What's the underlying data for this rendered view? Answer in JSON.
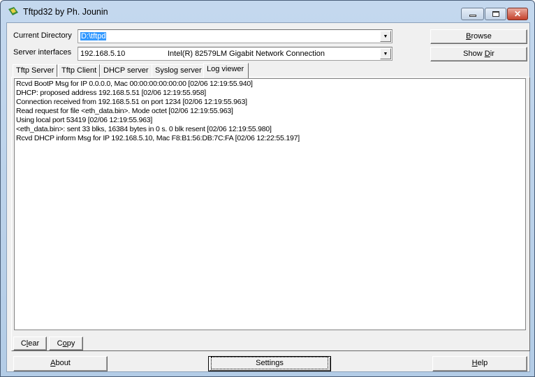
{
  "window": {
    "title": "Tftpd32 by Ph. Jounin",
    "minimize": "minimize",
    "maximize": "maximize",
    "close": "✕"
  },
  "form": {
    "current_directory_label": "Current Directory",
    "current_directory_value": "D:\\tftpd",
    "server_interfaces_label": "Server interfaces",
    "server_interface_ip": "192.168.5.10",
    "server_interface_name": "Intel(R) 82579LM Gigabit Network Connection",
    "browse": {
      "u": "B",
      "rest": "rowse"
    },
    "showdir": {
      "pre": "Show ",
      "u": "D",
      "rest": "ir"
    }
  },
  "tabs": [
    "Tftp Server",
    "Tftp Client",
    "DHCP server",
    "Syslog server",
    "Log viewer"
  ],
  "active_tab": "Log viewer",
  "log": [
    "Rcvd BootP Msg for IP 0.0.0.0, Mac 00:00:00:00:00:00 [02/06 12:19:55.940]",
    "DHCP: proposed address 192.168.5.51 [02/06 12:19:55.958]",
    "Connection received from 192.168.5.51 on port 1234 [02/06 12:19:55.963]",
    "Read request for file <eth_data.bin>. Mode octet [02/06 12:19:55.963]",
    "Using local port 53419 [02/06 12:19:55.963]",
    "<eth_data.bin>: sent 33 blks, 16384 bytes in 0 s. 0 blk resent [02/06 12:19:55.980]",
    "Rcvd DHCP inform Msg for IP 192.168.5.10, Mac F8:B1:56:DB:7C:FA [02/06 12:22:55.197]"
  ],
  "log_buttons": {
    "clear": {
      "pre": "C",
      "u": "l",
      "rest": "ear"
    },
    "copy": {
      "pre": "C",
      "u": "o",
      "rest": "py"
    }
  },
  "bottom": {
    "about": {
      "u": "A",
      "rest": "bout"
    },
    "settings": "Settings",
    "help": {
      "u": "H",
      "rest": "elp"
    }
  }
}
